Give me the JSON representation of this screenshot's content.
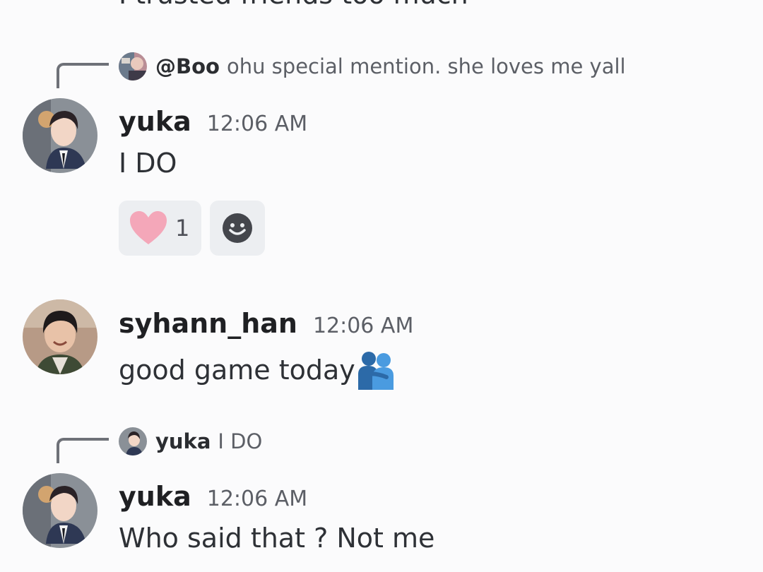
{
  "cutoff_text": "I trusted friends too much",
  "messages": [
    {
      "reply": {
        "name": "@Boo",
        "text": "ohu special mention. she loves me yall"
      },
      "username": "yuka",
      "time": "12:06 AM",
      "text": "I DO",
      "reactions": [
        {
          "icon": "heart-icon",
          "emoji": "❤",
          "count": "1"
        }
      ]
    },
    {
      "username": "syhann_han",
      "time": "12:06 AM",
      "text": "good game today",
      "emoji": "hugging-people-emoji"
    },
    {
      "reply": {
        "name": "yuka",
        "text": "I DO"
      },
      "username": "yuka",
      "time": "12:06 AM",
      "text": "Who said that ? Not me"
    }
  ],
  "colors": {
    "background": "#fbfbfc",
    "heart": "#f4a7b9",
    "reaction_bg": "#eceef1",
    "spine": "#6e7178",
    "hug_emoji": "#4a9be0"
  }
}
